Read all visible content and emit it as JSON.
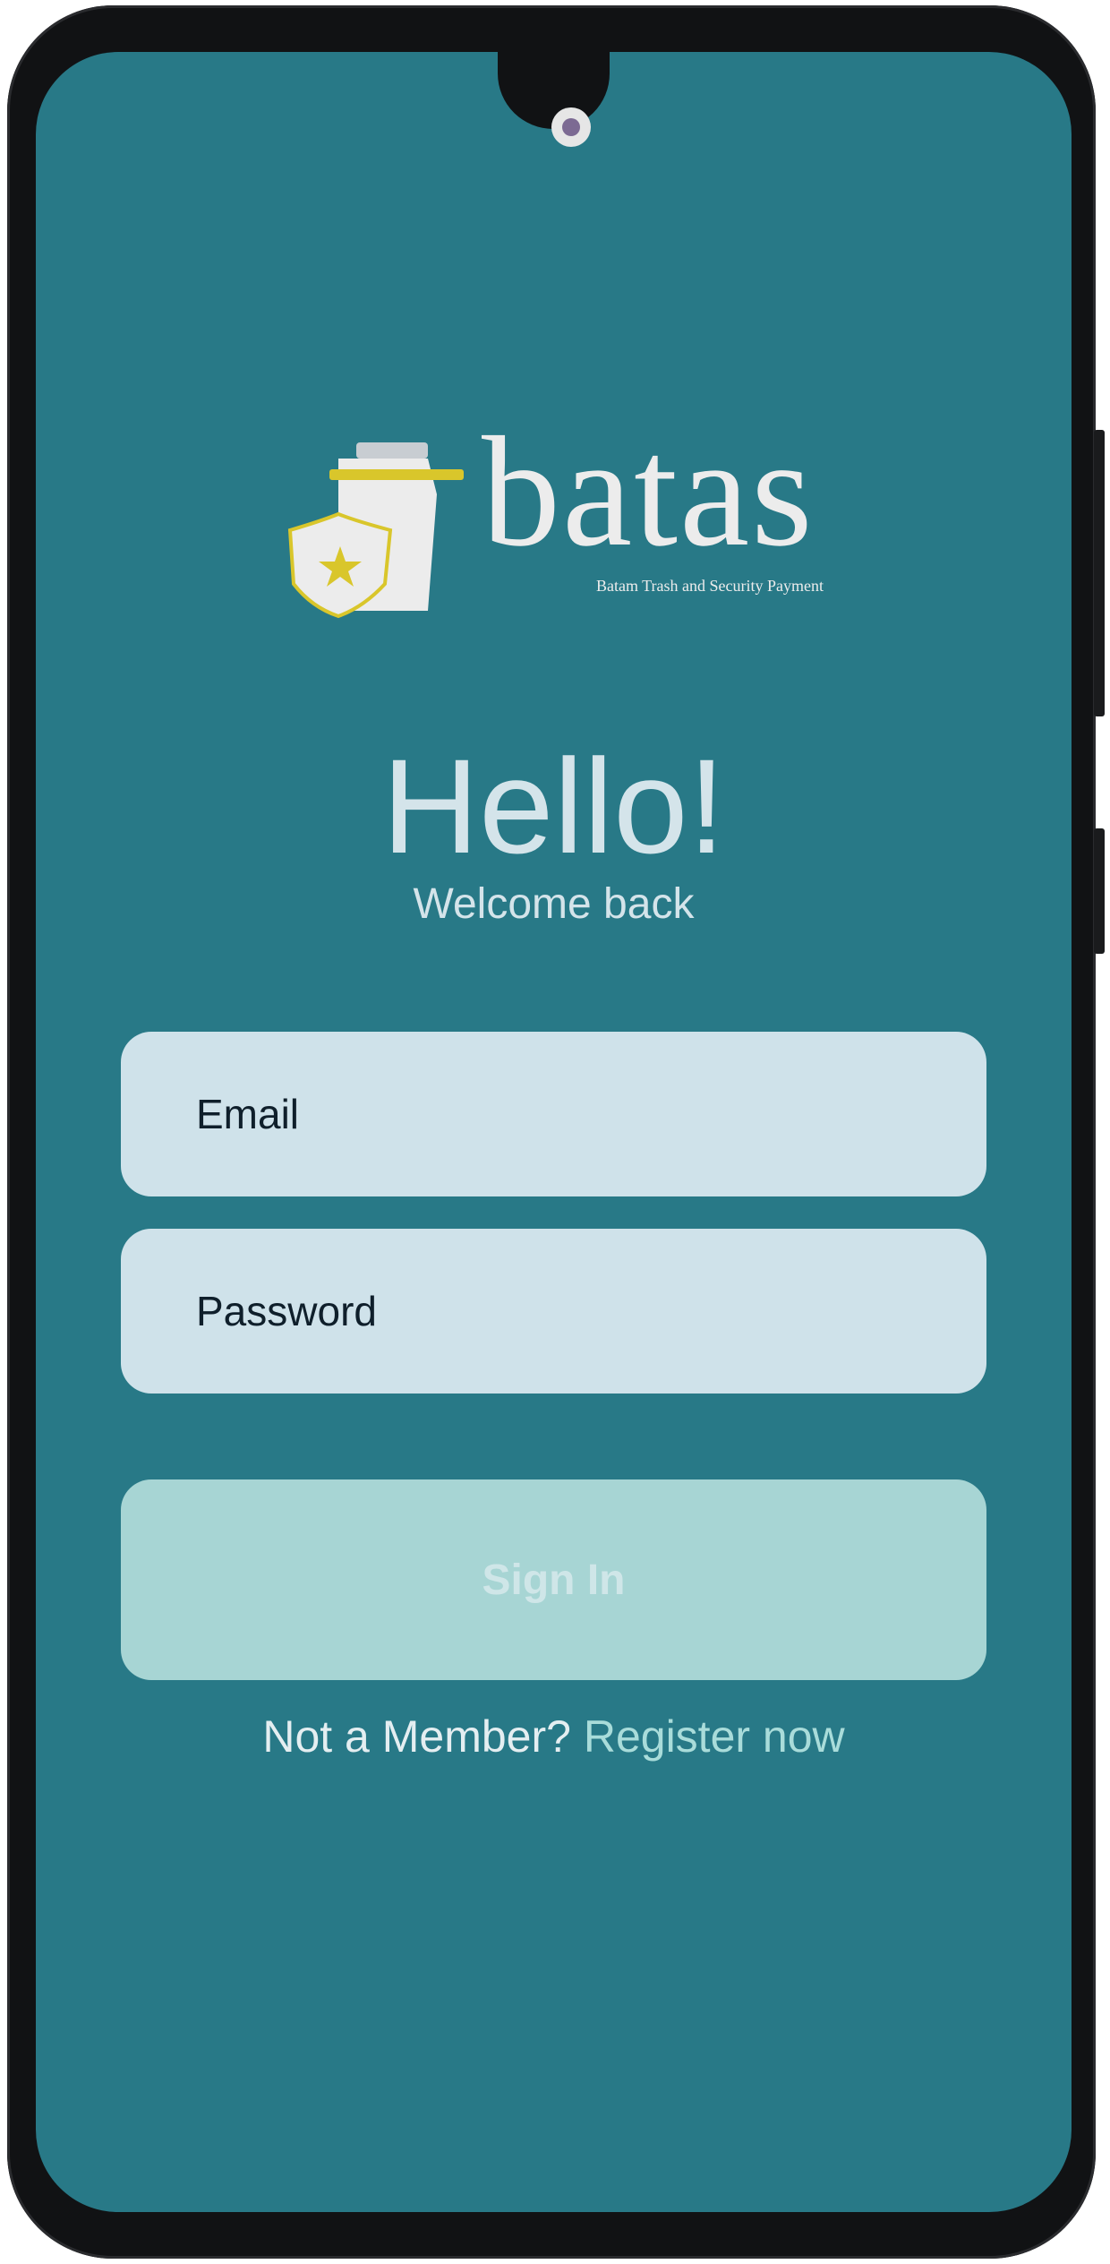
{
  "brand": {
    "name": "batas",
    "tagline": "Batam Trash and Security Payment",
    "logo_icon": "trash-bin-with-shield-icon"
  },
  "greeting": {
    "title": "Hello!",
    "subtitle": "Welcome back"
  },
  "form": {
    "email_placeholder": "Email",
    "email_value": "",
    "password_placeholder": "Password",
    "password_value": "",
    "submit_label": "Sign In"
  },
  "footer": {
    "prompt": "Not a Member?",
    "register_label": "Register now"
  },
  "colors": {
    "background": "#287987",
    "field": "#cfe2ea",
    "button": "#a7d5d4",
    "link": "#a9dcda",
    "accent_yellow": "#d9c62b"
  }
}
